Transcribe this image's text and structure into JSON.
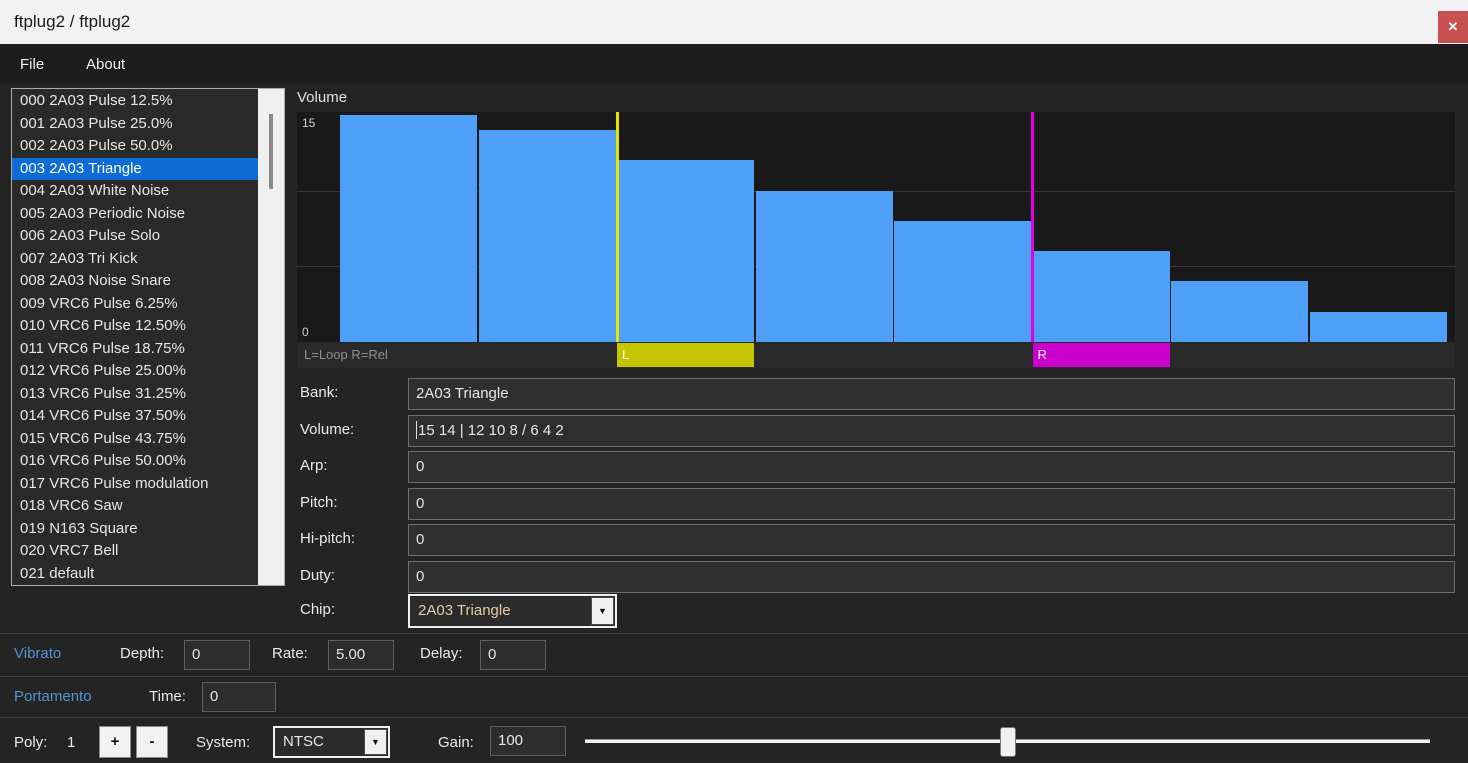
{
  "window": {
    "title": "ftplug2 / ftplug2"
  },
  "icons": {
    "close": "✕",
    "dropdown_arrow": "▼"
  },
  "menu": {
    "file": "File",
    "about": "About"
  },
  "instruments": {
    "selected_index": 3,
    "items": [
      "000 2A03 Pulse 12.5%",
      "001 2A03 Pulse 25.0%",
      "002 2A03 Pulse 50.0%",
      "003 2A03 Triangle",
      "004 2A03 White Noise",
      "005 2A03 Periodic Noise",
      "006 2A03 Pulse Solo",
      "007 2A03 Tri Kick",
      "008 2A03 Noise Snare",
      "009 VRC6 Pulse 6.25%",
      "010 VRC6 Pulse 12.50%",
      "011 VRC6 Pulse 18.75%",
      "012 VRC6 Pulse 25.00%",
      "013 VRC6 Pulse 31.25%",
      "014 VRC6 Pulse 37.50%",
      "015 VRC6 Pulse 43.75%",
      "016 VRC6 Pulse 50.00%",
      "017 VRC6 Pulse modulation",
      "018 VRC6 Saw",
      "019 N163 Square",
      "020 VRC7 Bell",
      "021 default"
    ]
  },
  "volume_chart": {
    "type": "bar",
    "title": "Volume",
    "y_max": 15,
    "y_max_label": "15",
    "y_min_label": "0",
    "values": [
      15,
      14,
      12,
      10,
      8,
      6,
      4,
      2
    ],
    "loop_index": 2,
    "release_index": 5,
    "gridlines": [
      5,
      10
    ],
    "legend": "L=Loop R=Rel",
    "loop_label": "L",
    "release_label": "R"
  },
  "fields": [
    {
      "label": "Bank:",
      "value": "2A03 Triangle",
      "focused": false
    },
    {
      "label": "Volume:",
      "value": "15 14 | 12 10 8 / 6 4 2",
      "focused": true
    },
    {
      "label": "Arp:",
      "value": "0",
      "focused": false
    },
    {
      "label": "Pitch:",
      "value": "0",
      "focused": false
    },
    {
      "label": "Hi-pitch:",
      "value": "0",
      "focused": false
    },
    {
      "label": "Duty:",
      "value": "0",
      "focused": false
    }
  ],
  "chip": {
    "label": "Chip:",
    "value": "2A03 Triangle"
  },
  "vibrato": {
    "title": "Vibrato",
    "depth_label": "Depth:",
    "depth": "0",
    "rate_label": "Rate:",
    "rate": "5.00",
    "delay_label": "Delay:",
    "delay": "0"
  },
  "portamento": {
    "title": "Portamento",
    "time_label": "Time:",
    "time": "0"
  },
  "poly": {
    "label": "Poly:",
    "value": "1",
    "increment": "+",
    "decrement": "-"
  },
  "system": {
    "label": "System:",
    "value": "NTSC"
  },
  "gain": {
    "label": "Gain:",
    "value": "100",
    "slider_percent": 50
  },
  "colors": {
    "bar": "#4d9ff7",
    "selection": "#0e6cd6",
    "loop": "#e4e400",
    "release": "#e400e4",
    "accent_text": "#4f94d5",
    "close_button": "#c75050",
    "titlebar": "#f2f2f2"
  }
}
